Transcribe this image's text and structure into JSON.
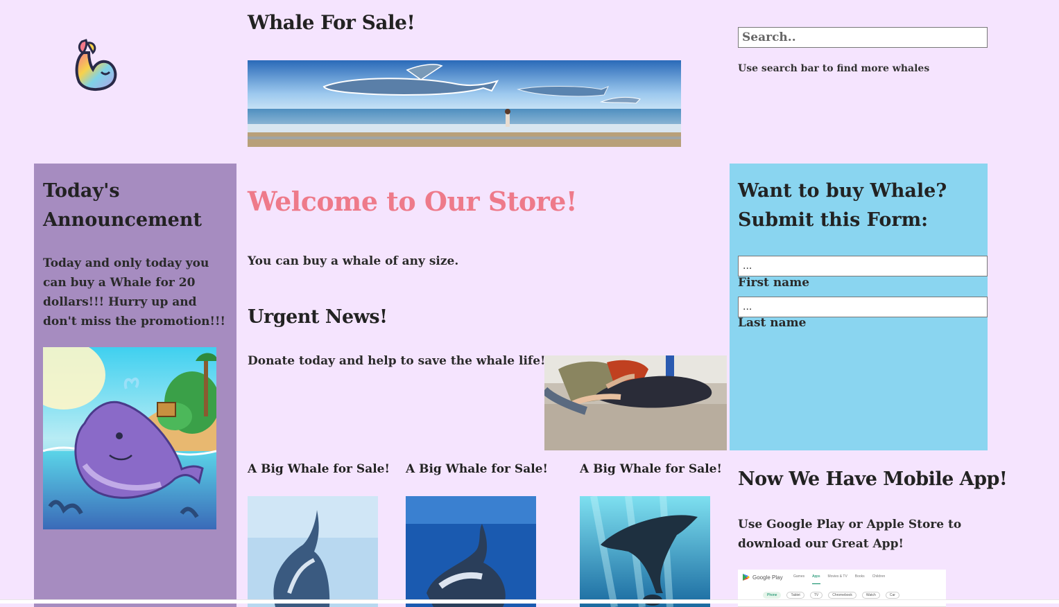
{
  "header": {
    "site_title": "Whale For Sale!",
    "search_placeholder": "Search..",
    "search_hint": "Use search bar to find more whales"
  },
  "announcement": {
    "title": "Today's Announcement",
    "text": "Today and only today you can buy a Whale for 20 dollars!!! Hurry up and don't miss the promotion!!!"
  },
  "main": {
    "welcome": "Welcome to Our Store!",
    "any_size": "You can buy a whale of any size.",
    "urgent_title": "Urgent News!",
    "donate": "Donate today and help to save the whale life!",
    "sale_items": [
      {
        "title": "A Big Whale for Sale!"
      },
      {
        "title": "A Big Whale for Sale!"
      },
      {
        "title": "A Big Whale for Sale!"
      }
    ]
  },
  "form": {
    "title": "Want to buy Whale? Submit this Form:",
    "first_name_value": "...",
    "first_name_label": "First name",
    "last_name_value": "...",
    "last_name_label": "Last name"
  },
  "app": {
    "title": "Now We Have Mobile App!",
    "text": "Use Google Play or Apple Store to download our Great App!",
    "gplay": {
      "brand": "Google Play",
      "tabs": [
        "Games",
        "Apps",
        "Movies & TV",
        "Books",
        "Children"
      ],
      "active_tab": "Apps",
      "chips": [
        "Phone",
        "Tablet",
        "TV",
        "Chromebook",
        "Watch",
        "Car"
      ]
    }
  },
  "colors": {
    "page_bg": "#f5e4fe",
    "left_panel": "#a68cc0",
    "form_panel": "#8ad5f0",
    "welcome_pink": "#ee7a8a"
  }
}
